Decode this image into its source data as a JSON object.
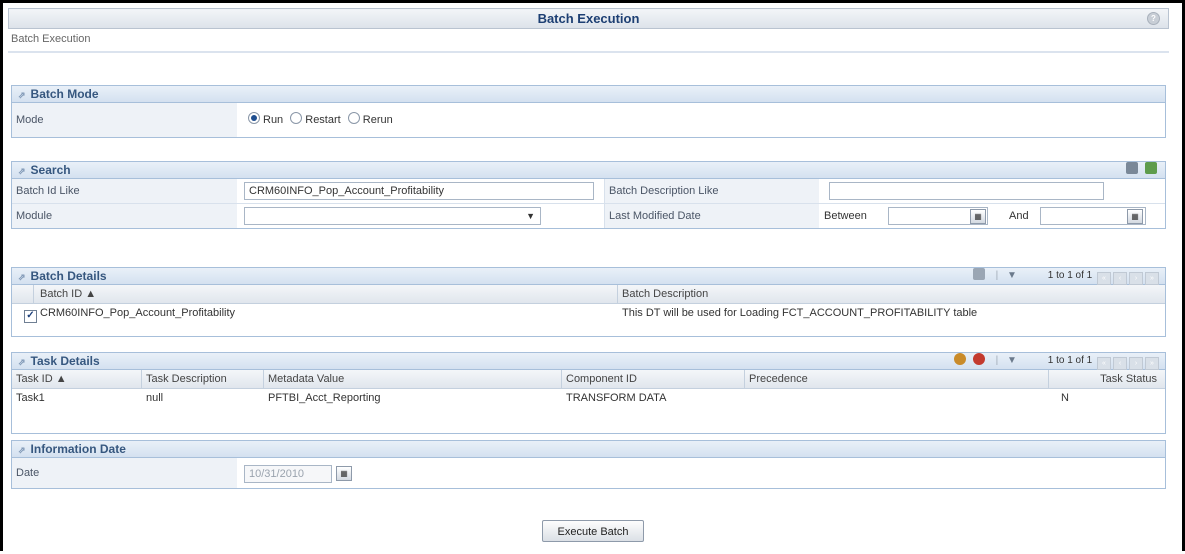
{
  "header": {
    "title": "Batch Execution",
    "breadcrumb": "Batch Execution"
  },
  "batch_mode": {
    "title": "Batch Mode",
    "mode_label": "Mode",
    "options": [
      {
        "label": "Run",
        "selected": true
      },
      {
        "label": "Restart",
        "selected": false
      },
      {
        "label": "Rerun",
        "selected": false
      }
    ]
  },
  "search": {
    "title": "Search",
    "batch_id_label": "Batch Id Like",
    "batch_id_value": "CRM60INFO_Pop_Account_Profitability",
    "batch_desc_label": "Batch Description Like",
    "batch_desc_value": "",
    "module_label": "Module",
    "module_value": "",
    "last_modified_label": "Last Modified Date",
    "between_label": "Between",
    "between_value": "",
    "and_label": "And",
    "and_value": ""
  },
  "batch_details": {
    "title": "Batch Details",
    "pagination": "1 to 1 of 1",
    "columns": [
      "Batch ID ▲",
      "Batch Description"
    ],
    "rows": [
      {
        "checked": true,
        "batch_id": "CRM60INFO_Pop_Account_Profitability",
        "description": "This DT will be used for Loading FCT_ACCOUNT_PROFITABILITY table"
      }
    ]
  },
  "task_details": {
    "title": "Task Details",
    "pagination": "1 to 1 of 1",
    "columns": [
      "Task ID ▲",
      "Task Description",
      "Metadata Value",
      "Component ID",
      "Precedence",
      "Task Status"
    ],
    "rows": [
      {
        "task_id": "Task1",
        "description": "null",
        "metadata": "PFTBI_Acct_Reporting",
        "component": "TRANSFORM DATA",
        "precedence": "",
        "status": "N"
      }
    ]
  },
  "info_date": {
    "title": "Information Date",
    "date_label": "Date",
    "date_value": "10/31/2010"
  },
  "execute_button": "Execute Batch",
  "colors": {
    "accent": "#36577f",
    "panel_border": "#a7bfda",
    "header_bg": "#d4e1f0"
  }
}
